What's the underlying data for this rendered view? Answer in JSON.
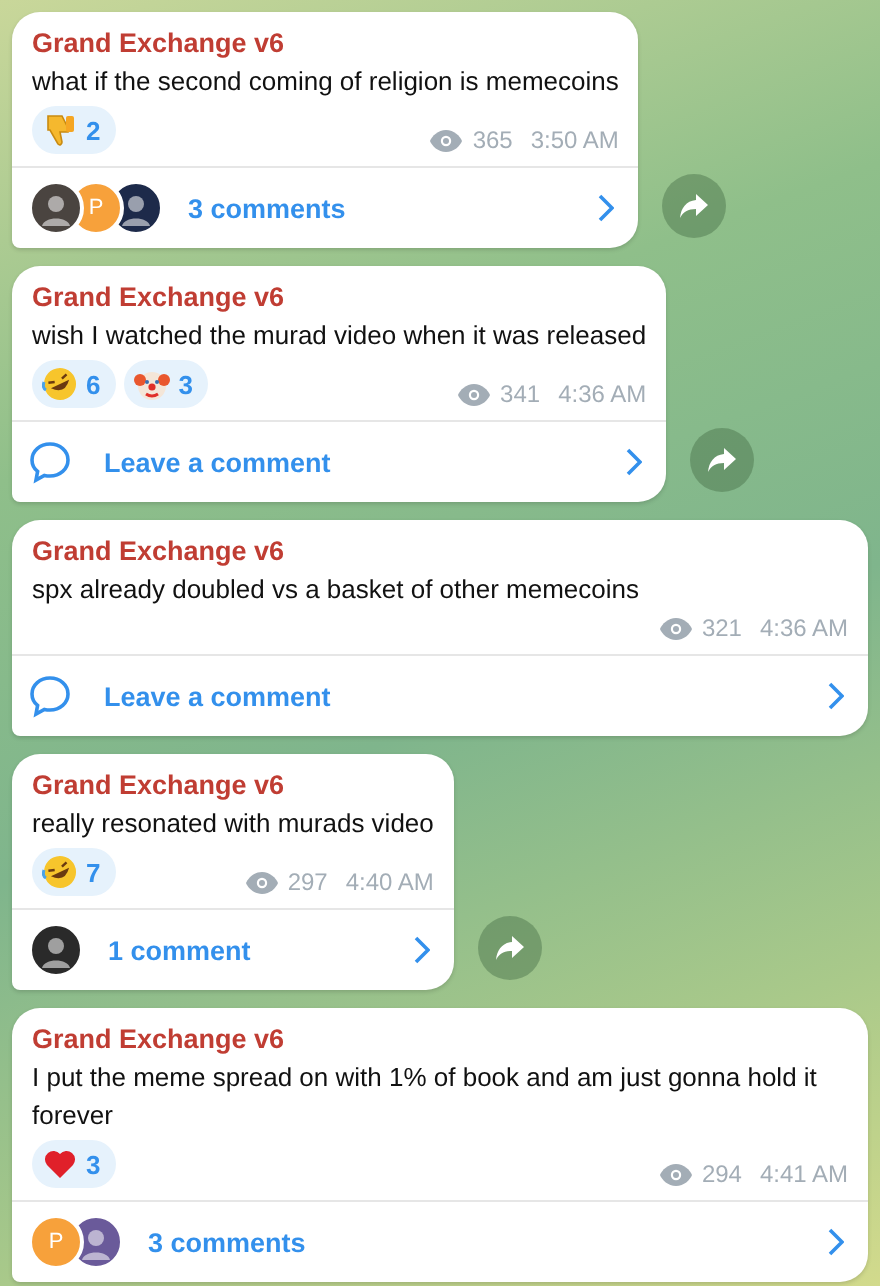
{
  "messages": [
    {
      "author": "Grand Exchange v6",
      "text": "what if the second coming of religion is memecoins",
      "reactions": [
        {
          "kind": "thumbs-down",
          "count": "2"
        }
      ],
      "views": "365",
      "time": "3:50 AM",
      "comments": {
        "avatars": [
          {
            "kind": "photo",
            "color": "#4a4440"
          },
          {
            "kind": "letter",
            "letter": "P",
            "color": "#f7a13b"
          },
          {
            "kind": "photo",
            "color": "#1d2a4a"
          }
        ],
        "label": "3 comments"
      },
      "share_button": true
    },
    {
      "author": "Grand Exchange v6",
      "text": "wish I watched the murad video when it was released",
      "reactions": [
        {
          "kind": "rofl",
          "count": "6"
        },
        {
          "kind": "clown",
          "count": "3"
        }
      ],
      "views": "341",
      "time": "4:36 AM",
      "comments": {
        "label": "Leave a comment"
      },
      "share_button": true
    },
    {
      "author": "Grand Exchange v6",
      "text": "spx already doubled vs a basket of other memecoins",
      "views": "321",
      "time": "4:36 AM",
      "comments": {
        "label": "Leave a comment"
      },
      "share_button": false
    },
    {
      "author": "Grand Exchange v6",
      "text": "really resonated with murads video",
      "reactions": [
        {
          "kind": "rofl",
          "count": "7"
        }
      ],
      "views": "297",
      "time": "4:40 AM",
      "comments": {
        "avatars": [
          {
            "kind": "photo",
            "color": "#2a2a2a"
          }
        ],
        "label": "1 comment"
      },
      "share_button": true
    },
    {
      "author": "Grand Exchange v6",
      "text": "I put the meme spread on with 1% of book and am just gonna hold it forever",
      "reactions": [
        {
          "kind": "heart",
          "count": "3"
        }
      ],
      "views": "294",
      "time": "4:41 AM",
      "comments": {
        "avatars": [
          {
            "kind": "letter",
            "letter": "P",
            "color": "#f7a13b"
          },
          {
            "kind": "photo",
            "color": "#6a5a9a"
          }
        ],
        "label": "3 comments"
      },
      "share_button": false
    }
  ]
}
